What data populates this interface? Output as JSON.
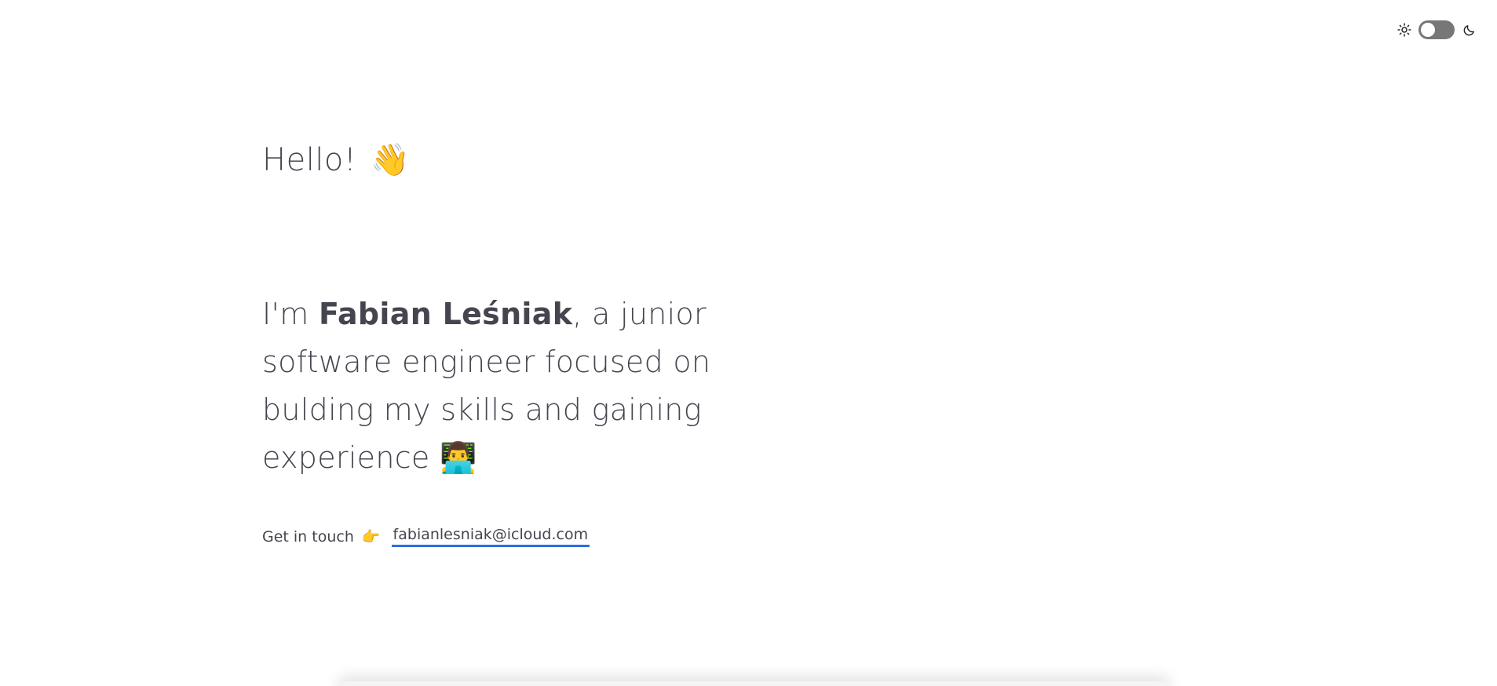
{
  "theme_toggle": {
    "light_icon": "sun-icon",
    "dark_icon": "moon-icon",
    "state": "light",
    "track_color": "#777777"
  },
  "greeting": {
    "text": "Hello!",
    "emoji": "👋"
  },
  "intro": {
    "prefix": "I'm ",
    "name": "Fabian Leśniak",
    "suffix": ", a junior software engineer focused on bulding my skills and gaining experience",
    "emoji": "👨‍💻"
  },
  "contact": {
    "label": "Get in touch",
    "emoji": "👉",
    "email": "fabianlesniak@icloud.com",
    "underline_color": "#2d6ee0"
  }
}
